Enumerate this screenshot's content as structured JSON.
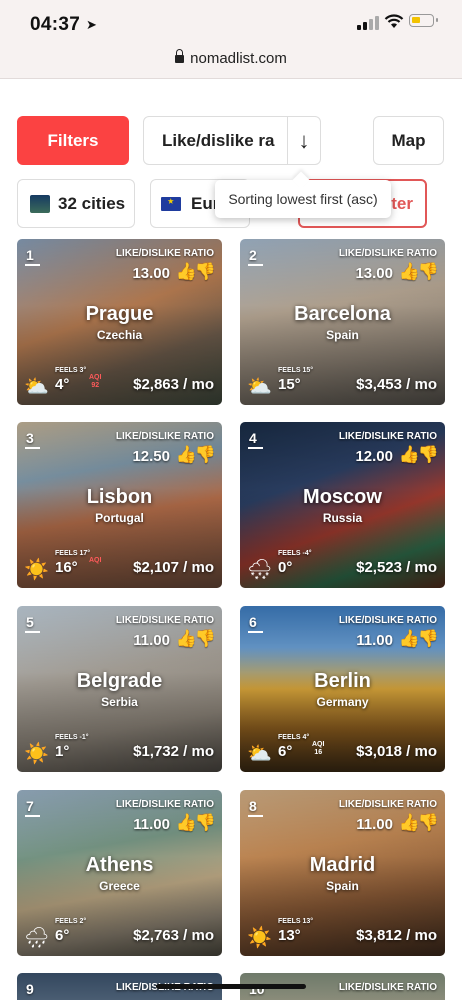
{
  "status": {
    "time": "04:37"
  },
  "browser": {
    "url": "nomadlist.com"
  },
  "controls": {
    "filters": "Filters",
    "sort": "Like/dislike ra",
    "sort_direction": "↓",
    "map": "Map",
    "cities_count": "32 cities",
    "region": "Eur",
    "filter": "ter",
    "tooltip": "Sorting lowest first (asc)"
  },
  "colors": {
    "accent": "#fb4242",
    "outline_red": "#e15757"
  },
  "cards": [
    {
      "rank": "1",
      "ratio_label": "LIKE/DISLIKE RATIO",
      "ratio": "13.00",
      "city": "Prague",
      "country": "Czechia",
      "feels": "FEELS 3°",
      "weather": "partly-cloudy-icon",
      "temp": "4°",
      "aqi_label": "AQI",
      "aqi": "92",
      "price": "$2,863 / mo"
    },
    {
      "rank": "2",
      "ratio_label": "LIKE/DISLIKE RATIO",
      "ratio": "13.00",
      "city": "Barcelona",
      "country": "Spain",
      "feels": "FEELS 15°",
      "weather": "partly-cloudy-icon",
      "temp": "15°",
      "aqi_label": "",
      "aqi": "",
      "price": "$3,453 / mo"
    },
    {
      "rank": "3",
      "ratio_label": "LIKE/DISLIKE RATIO",
      "ratio": "12.50",
      "city": "Lisbon",
      "country": "Portugal",
      "feels": "FEELS 17°",
      "weather": "sun-icon",
      "temp": "16°",
      "aqi_label": "AQI",
      "aqi": "",
      "price": "$2,107 / mo"
    },
    {
      "rank": "4",
      "ratio_label": "LIKE/DISLIKE RATIO",
      "ratio": "12.00",
      "city": "Moscow",
      "country": "Russia",
      "feels": "FEELS -4°",
      "weather": "snow-cloud-icon",
      "temp": "0°",
      "aqi_label": "",
      "aqi": "",
      "price": "$2,523 / mo"
    },
    {
      "rank": "5",
      "ratio_label": "LIKE/DISLIKE RATIO",
      "ratio": "11.00",
      "city": "Belgrade",
      "country": "Serbia",
      "feels": "FEELS -1°",
      "weather": "sun-icon",
      "temp": "1°",
      "aqi_label": "",
      "aqi": "",
      "price": "$1,732 / mo"
    },
    {
      "rank": "6",
      "ratio_label": "LIKE/DISLIKE RATIO",
      "ratio": "11.00",
      "city": "Berlin",
      "country": "Germany",
      "feels": "FEELS 4°",
      "weather": "partly-cloudy-icon",
      "temp": "6°",
      "aqi_label": "AQI",
      "aqi": "16",
      "price": "$3,018 / mo"
    },
    {
      "rank": "7",
      "ratio_label": "LIKE/DISLIKE RATIO",
      "ratio": "11.00",
      "city": "Athens",
      "country": "Greece",
      "feels": "FEELS 2°",
      "weather": "rain-cloud-icon",
      "temp": "6°",
      "aqi_label": "",
      "aqi": "",
      "price": "$2,763 / mo"
    },
    {
      "rank": "8",
      "ratio_label": "LIKE/DISLIKE RATIO",
      "ratio": "11.00",
      "city": "Madrid",
      "country": "Spain",
      "feels": "FEELS 13°",
      "weather": "sun-icon",
      "temp": "13°",
      "aqi_label": "",
      "aqi": "",
      "price": "$3,812 / mo"
    },
    {
      "rank": "9",
      "ratio_label": "LIKE/DISLIKE RATIO"
    },
    {
      "rank": "10",
      "ratio_label": "LIKE/DISLIKE RATIO"
    }
  ]
}
